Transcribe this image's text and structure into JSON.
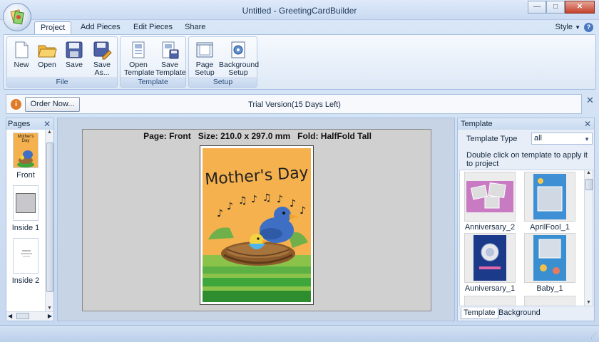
{
  "window": {
    "title": "Untitled - GreetingCardBuilder"
  },
  "tabs": [
    {
      "label": "Project",
      "active": true
    },
    {
      "label": "Add Pieces",
      "active": false
    },
    {
      "label": "Edit Pieces",
      "active": false
    },
    {
      "label": "Share",
      "active": false
    }
  ],
  "style_label": "Style",
  "ribbon": {
    "file": {
      "title": "File",
      "new": "New",
      "open": "Open",
      "save": "Save",
      "save_as": "Save As..."
    },
    "template": {
      "title": "Template",
      "open": "Open Template",
      "save": "Save Template"
    },
    "setup": {
      "title": "Setup",
      "page": "Page Setup",
      "background": "Background Setup"
    }
  },
  "trial": {
    "order_button": "Order Now...",
    "message": "Trial Version(15 Days Left)"
  },
  "pages_panel": {
    "title": "Pages",
    "items": [
      {
        "label": "Front",
        "thumb_title": "Mother's Day"
      },
      {
        "label": "Inside 1"
      },
      {
        "label": "Inside 2"
      }
    ]
  },
  "canvas": {
    "page_info": "Page: Front   Size: 210.0 x 297.0 mm   Fold: HalfFold Tall",
    "card_title": "Mother's Day"
  },
  "template_panel": {
    "title": "Template",
    "type_label": "Template Type",
    "type_value": "all",
    "hint": "Double click on template to apply it to project",
    "items": [
      {
        "name": "Anniversary_2"
      },
      {
        "name": "AprilFool_1"
      },
      {
        "name": "Auniversary_1"
      },
      {
        "name": "Baby_1"
      }
    ],
    "bottom_tabs": [
      {
        "label": "Template",
        "active": true
      },
      {
        "label": "Background",
        "active": false
      }
    ]
  },
  "colors": {
    "accent": "#4a78c0",
    "card_orange": "#f5b14d",
    "bird_blue": "#3e6fc4",
    "grass_green": "#3ea63a"
  }
}
